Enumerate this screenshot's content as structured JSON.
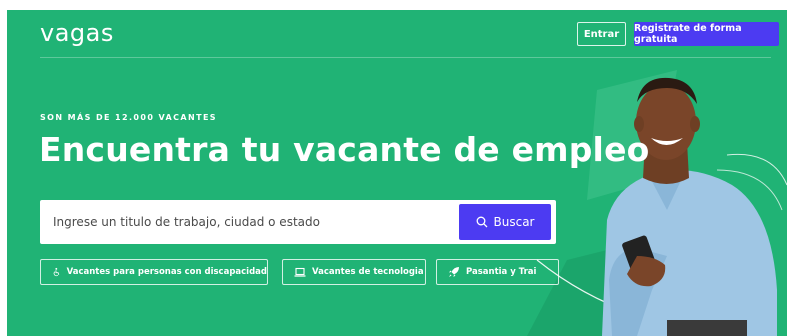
{
  "header": {
    "logo": "vagas",
    "login_label": "Entrar",
    "register_label": "Registrate de forma gratuita"
  },
  "hero": {
    "eyebrow": "SON MÁS DE 12.000 VACANTES",
    "title": "Encuentra tu vacante de empleo"
  },
  "search": {
    "placeholder": "Ingrese un titulo de trabajo, ciudad o estado",
    "button_label": "Buscar"
  },
  "chips": [
    {
      "label": "Vacantes para personas con discapacidad",
      "icon": "accessibility-icon"
    },
    {
      "label": "Vacantes de tecnologia",
      "icon": "laptop-icon"
    },
    {
      "label": "Pasantia y Trai",
      "icon": "rocket-icon"
    }
  ],
  "colors": {
    "background": "#20b375",
    "accent": "#4c3bf2",
    "text": "#ffffff"
  }
}
